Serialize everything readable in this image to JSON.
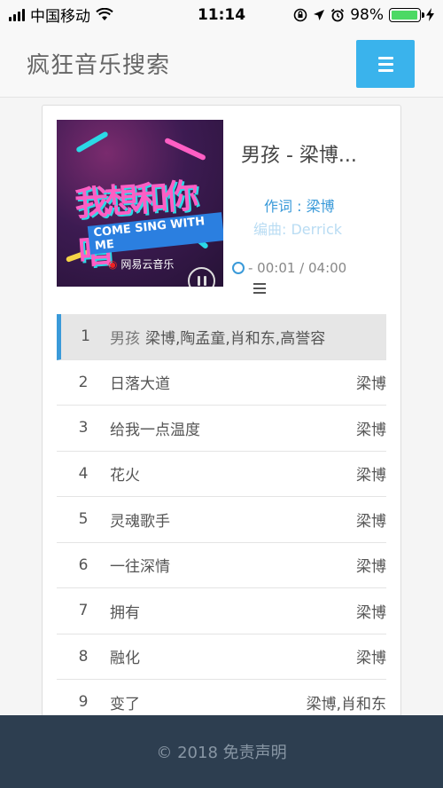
{
  "status": {
    "carrier": "中国移动",
    "time": "11:14",
    "battery": "98%",
    "battery_level": 0.98
  },
  "header": {
    "brand": "疯狂音乐搜索",
    "menu_icon": "hamburger-icon",
    "accent": "#3ab3ec"
  },
  "player": {
    "title": "男孩 - 梁博...",
    "lyric_line1": "作词 : 梁博",
    "lyric_line2": "编曲:  Derrick",
    "progress_text": "- 00:01 / 04:00",
    "cover": {
      "headline": "我想和你唱",
      "subline": "COME SING WITH ME",
      "brand": "网易云音乐"
    }
  },
  "playlist": [
    {
      "num": "1",
      "name": "男孩",
      "artist": "梁博,陶孟童,肖和东,高誉容",
      "active": true
    },
    {
      "num": "2",
      "name": "日落大道",
      "artist": "梁博"
    },
    {
      "num": "3",
      "name": "给我一点温度",
      "artist": "梁博"
    },
    {
      "num": "4",
      "name": "花火",
      "artist": "梁博"
    },
    {
      "num": "5",
      "name": "灵魂歌手",
      "artist": "梁博"
    },
    {
      "num": "6",
      "name": "一往深情",
      "artist": "梁博"
    },
    {
      "num": "7",
      "name": "拥有",
      "artist": "梁博"
    },
    {
      "num": "8",
      "name": "融化",
      "artist": "梁博"
    },
    {
      "num": "9",
      "name": "变了",
      "artist": "梁博,肖和东"
    }
  ],
  "footer": {
    "text": "© 2018 免责声明"
  }
}
